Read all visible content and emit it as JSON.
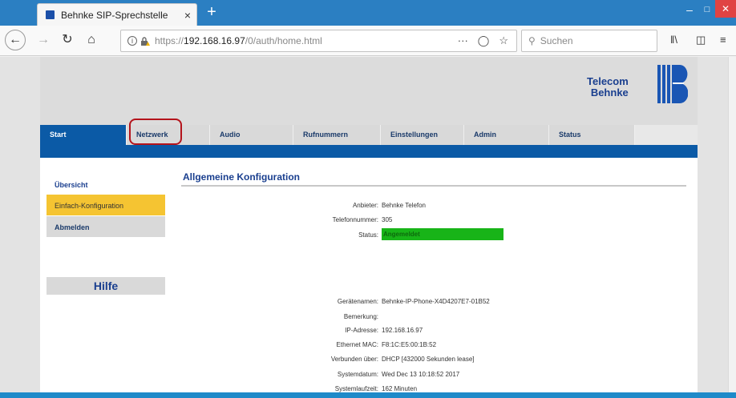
{
  "browser": {
    "tab_title": "Behnke SIP-Sprechstelle",
    "tab_close": "×",
    "new_tab": "+",
    "url_prefix": "https://",
    "url_host": "192.168.16.97",
    "url_path": "/0/auth/home.html",
    "search_placeholder": "Suchen",
    "url_menu": "···"
  },
  "colors": {
    "accent": "#0b5aa6",
    "sidebar_active": "#f5c432",
    "status_ok": "#18b418",
    "highlight": "#b4131b"
  },
  "logo": {
    "line1": "Telecom",
    "line2": "Behnke"
  },
  "menu": [
    {
      "label": "Start"
    },
    {
      "label": "Netzwerk"
    },
    {
      "label": "Audio"
    },
    {
      "label": "Rufnummern"
    },
    {
      "label": "Einstellungen"
    },
    {
      "label": "Admin"
    },
    {
      "label": "Status"
    }
  ],
  "sidebar": {
    "overview": "Übersicht",
    "simple_config": "Einfach-Konfiguration",
    "logout": "Abmelden",
    "help": "Hilfe"
  },
  "main": {
    "title": "Allgemeine Konfiguration",
    "rows": [
      {
        "label": "Anbieter:",
        "value": "Behnke Telefon"
      },
      {
        "label": "Telefonnummer:",
        "value": "305"
      },
      {
        "label": "Status:",
        "value": "Angemeldet"
      },
      {
        "label": "Gerätenamen:",
        "value": "Behnke-IP-Phone-X4D4207E7-01B52"
      },
      {
        "label": "Bemerkung:",
        "value": ""
      },
      {
        "label": "IP-Adresse:",
        "value": "192.168.16.97"
      },
      {
        "label": "Ethernet MAC:",
        "value": "F8:1C:E5:00:1B:52"
      },
      {
        "label": "Verbunden über:",
        "value": "DHCP  [432000 Sekunden lease]"
      },
      {
        "label": "Systemdatum:",
        "value": "Wed Dec 13 10:18:52 2017"
      },
      {
        "label": "Systemlaufzeit:",
        "value": "162 Minuten"
      }
    ]
  }
}
